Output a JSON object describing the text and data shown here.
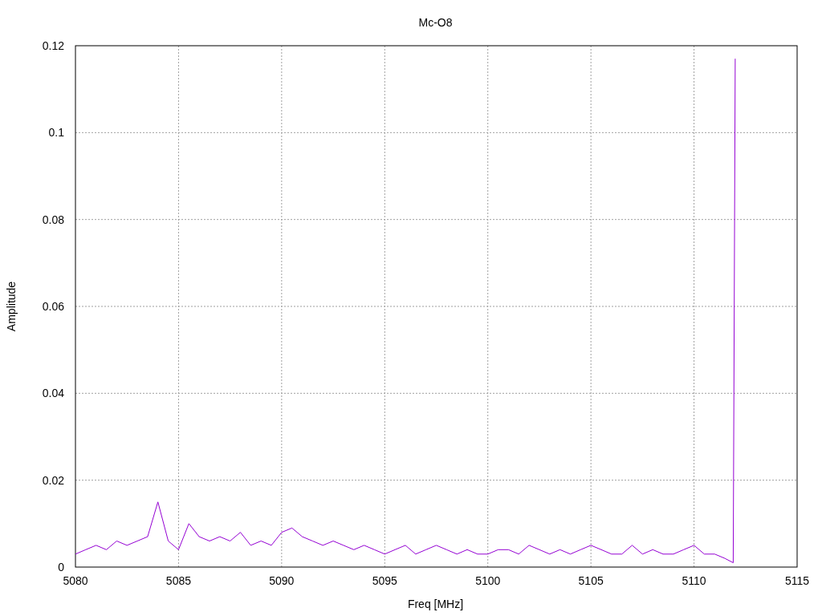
{
  "chart_data": {
    "type": "line",
    "title": "Mc-O8",
    "xlabel": "Freq [MHz]",
    "ylabel": "Amplitude",
    "x": [
      5080,
      5080.5,
      5081,
      5081.5,
      5082,
      5082.5,
      5083,
      5083.5,
      5084,
      5084.5,
      5085,
      5085.5,
      5086,
      5086.5,
      5087,
      5087.5,
      5088,
      5088.5,
      5089,
      5089.5,
      5090,
      5090.5,
      5091,
      5091.5,
      5092,
      5092.5,
      5093,
      5093.5,
      5094,
      5094.5,
      5095,
      5095.5,
      5096,
      5096.5,
      5097,
      5097.5,
      5098,
      5098.5,
      5099,
      5099.5,
      5100,
      5100.5,
      5101,
      5101.5,
      5102,
      5102.5,
      5103,
      5103.5,
      5104,
      5104.5,
      5105,
      5105.5,
      5106,
      5106.5,
      5107,
      5107.5,
      5108,
      5108.5,
      5109,
      5109.5,
      5110,
      5110.5,
      5111,
      5111.5,
      5111.9,
      5112
    ],
    "grid": true,
    "series": [
      {
        "color": "#9400d3",
        "values": [
          0.003,
          0.004,
          0.005,
          0.004,
          0.006,
          0.005,
          0.006,
          0.007,
          0.015,
          0.006,
          0.004,
          0.01,
          0.007,
          0.006,
          0.007,
          0.006,
          0.008,
          0.005,
          0.006,
          0.005,
          0.008,
          0.009,
          0.007,
          0.006,
          0.005,
          0.006,
          0.005,
          0.004,
          0.005,
          0.004,
          0.003,
          0.004,
          0.005,
          0.003,
          0.004,
          0.005,
          0.004,
          0.003,
          0.004,
          0.003,
          0.003,
          0.004,
          0.004,
          0.003,
          0.005,
          0.004,
          0.003,
          0.004,
          0.003,
          0.004,
          0.005,
          0.004,
          0.003,
          0.003,
          0.005,
          0.003,
          0.004,
          0.003,
          0.003,
          0.004,
          0.005,
          0.003,
          0.003,
          0.002,
          0.001,
          0.117
        ]
      }
    ],
    "xlim": [
      5080,
      5115
    ],
    "ylim": [
      0,
      0.12
    ],
    "xticks": [
      5080,
      5085,
      5090,
      5095,
      5100,
      5105,
      5110,
      5115
    ],
    "yticks": [
      {
        "value": 0,
        "label": "0"
      },
      {
        "value": 0.02,
        "label": "0.02"
      },
      {
        "value": 0.04,
        "label": "0.04"
      },
      {
        "value": 0.06,
        "label": "0.06"
      },
      {
        "value": 0.08,
        "label": "0.08"
      },
      {
        "value": 0.1,
        "label": "0.1"
      },
      {
        "value": 0.12,
        "label": "0.12"
      }
    ]
  }
}
